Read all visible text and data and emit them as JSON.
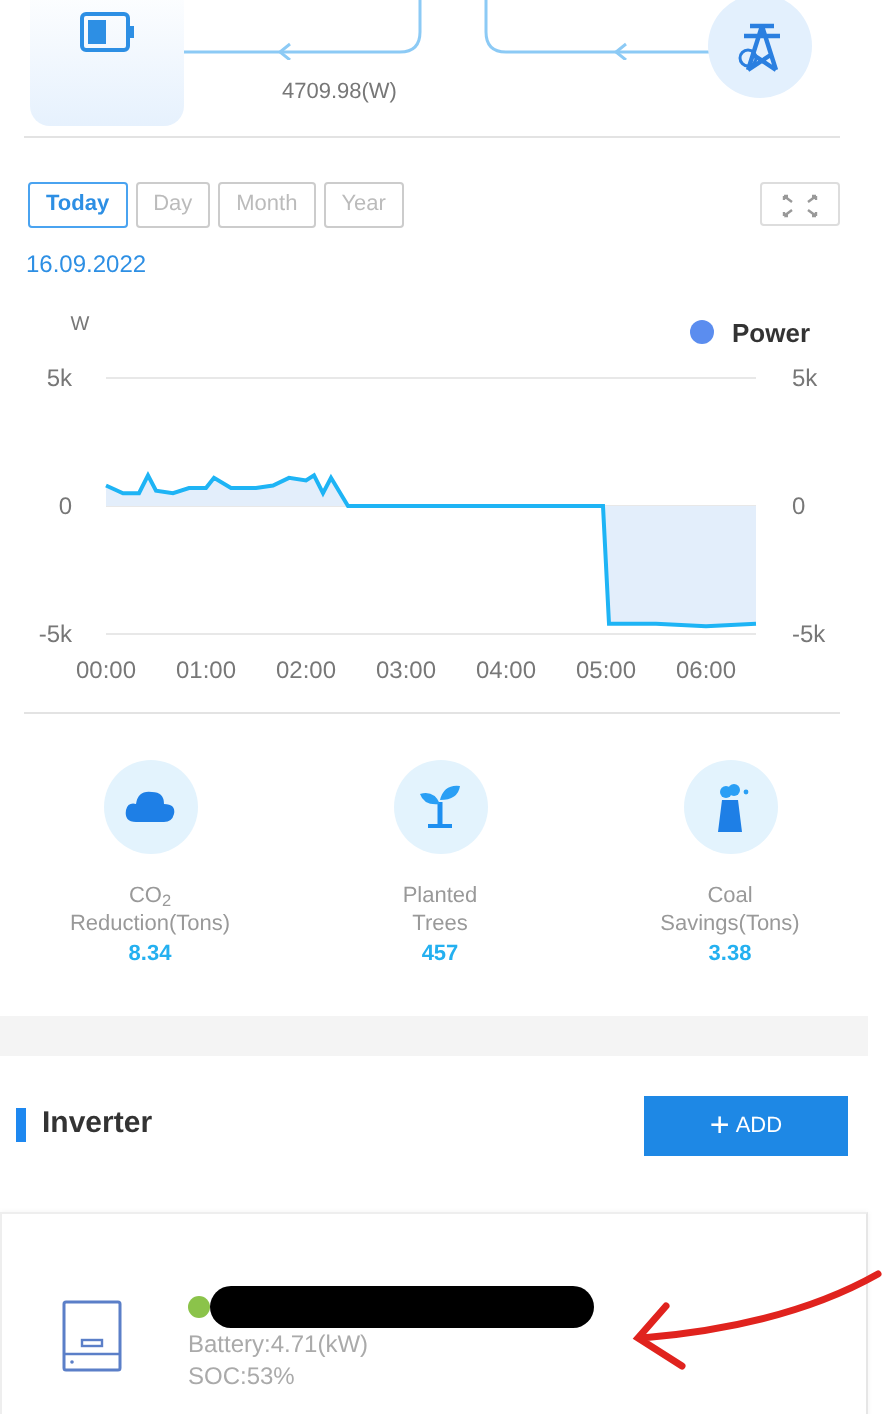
{
  "flow": {
    "reading": "4709.98(W)"
  },
  "tabs": [
    {
      "label": "Today",
      "selected": true
    },
    {
      "label": "Day",
      "selected": false
    },
    {
      "label": "Month",
      "selected": false
    },
    {
      "label": "Year",
      "selected": false
    }
  ],
  "date": "16.09.2022",
  "chart_data": {
    "type": "area",
    "ylabel": "W",
    "x": [
      0,
      0.17,
      0.33,
      0.42,
      0.5,
      0.67,
      0.83,
      1.0,
      1.08,
      1.25,
      1.5,
      1.67,
      1.83,
      2.0,
      2.08,
      2.17,
      2.25,
      2.42,
      3.0,
      4.0,
      4.97,
      5.03,
      5.5,
      6.0,
      6.5
    ],
    "series": [
      {
        "name": "Power",
        "values": [
          800,
          500,
          500,
          1200,
          600,
          500,
          700,
          700,
          1100,
          700,
          700,
          800,
          1100,
          1000,
          1200,
          500,
          1100,
          0,
          0,
          0,
          0,
          -4600,
          -4600,
          -4700,
          -4600
        ]
      }
    ],
    "xlim": [
      0,
      6.5
    ],
    "ylim": [
      -5000,
      5000
    ],
    "xticks": [
      {
        "value": 0,
        "label": "00:00"
      },
      {
        "value": 1,
        "label": "01:00"
      },
      {
        "value": 2,
        "label": "02:00"
      },
      {
        "value": 3,
        "label": "03:00"
      },
      {
        "value": 4,
        "label": "04:00"
      },
      {
        "value": 5,
        "label": "05:00"
      },
      {
        "value": 6,
        "label": "06:00"
      }
    ],
    "yticks": [
      {
        "value": 5000,
        "label": "5k"
      },
      {
        "value": 0,
        "label": "0"
      },
      {
        "value": -5000,
        "label": "-5k"
      }
    ]
  },
  "stats": [
    {
      "kind": "co2",
      "label": "CO$_{2}$",
      "label_2": "Reduction(Tons)",
      "value": "8.34"
    },
    {
      "kind": "tree",
      "label": "Planted",
      "label_2": "Trees",
      "value": "457"
    },
    {
      "kind": "coal",
      "label": "Coal",
      "label_2": "Savings(Tons)",
      "value": "3.38"
    }
  ],
  "section": {
    "title": "Inverter",
    "button": "ADD",
    "button_icon": "+"
  },
  "device": {
    "color": "#8bc34a",
    "battery": "Battery:4.71(kW)",
    "soc": "SOC:53%"
  }
}
